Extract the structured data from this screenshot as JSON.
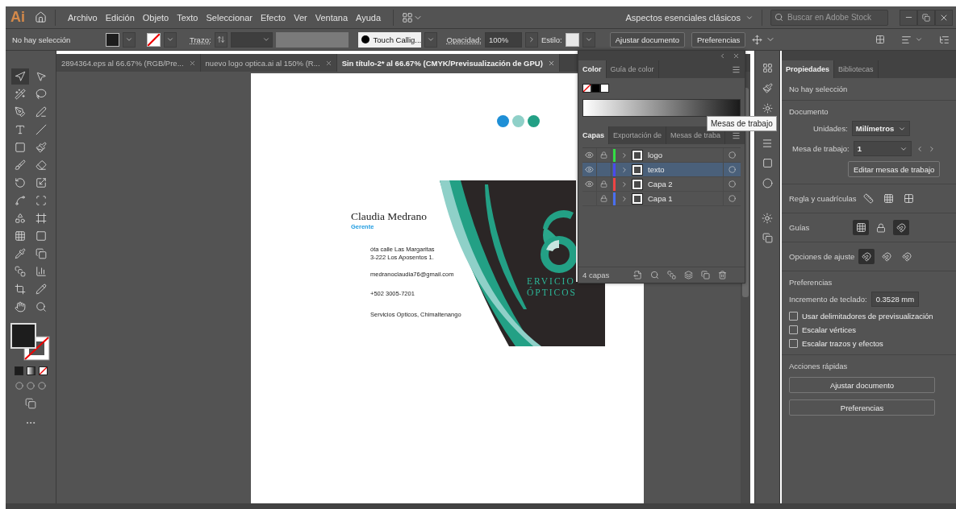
{
  "app": {
    "logo": "Ai"
  },
  "menu": [
    "Archivo",
    "Edición",
    "Objeto",
    "Texto",
    "Seleccionar",
    "Efecto",
    "Ver",
    "Ventana",
    "Ayuda"
  ],
  "workspace": "Aspectos esenciales clásicos",
  "search": {
    "placeholder": "Buscar en Adobe Stock"
  },
  "control_bar": {
    "selection": "No hay selección",
    "stroke_label": "Trazo:",
    "brush": "Touch Callig...",
    "opacity_label": "Opacidad:",
    "opacity": "100%",
    "style_label": "Estilo:",
    "buttons": [
      "Ajustar documento",
      "Preferencias"
    ]
  },
  "doc_tabs": [
    {
      "label": "2894364.eps al 66.67% (RGB/Pre...",
      "selected": false
    },
    {
      "label": "nuevo logo optica.ai al 150% (R...",
      "selected": false
    },
    {
      "label": "Sin título-2* al 66.67% (CMYK/Previsualización de GPU)",
      "selected": true
    }
  ],
  "card": {
    "name": "Claudia Medrano",
    "role": "Gerente",
    "address": [
      "óta calle Las Margaritas",
      "3-222  Los Aposentos 1."
    ],
    "email": "medranoclaudia76@gmail.com",
    "phone": "+502 3005-7201",
    "company": "Servicios Opticos, Chimaltenango",
    "logo_lines": [
      "ERVICIO",
      "ÓPTICOS"
    ],
    "dots": [
      {
        "color": "#1e8fd6"
      },
      {
        "color": "#8fd0c8"
      },
      {
        "color": "#23a085"
      }
    ]
  },
  "color_panel": {
    "tabs": [
      {
        "label": "Color",
        "selected": true
      },
      {
        "label": "Guía de color",
        "selected": false
      }
    ]
  },
  "layers_panel": {
    "tabs": [
      {
        "label": "Capas",
        "selected": true
      },
      {
        "label": "Exportación de",
        "selected": false
      },
      {
        "label": "Mesas de traba",
        "selected": false
      }
    ],
    "layers": [
      {
        "name": "logo",
        "visible": true,
        "locked": true,
        "color": "#33dd44",
        "selected": false
      },
      {
        "name": "texto",
        "visible": true,
        "locked": false,
        "color": "#4a4af0",
        "selected": true
      },
      {
        "name": "Capa 2",
        "visible": true,
        "locked": true,
        "color": "#ee4444",
        "selected": false
      },
      {
        "name": "Capa 1",
        "visible": false,
        "locked": true,
        "color": "#4a6ff0",
        "selected": false
      }
    ],
    "count": "4 capas"
  },
  "tooltip": "Mesas de trabajo",
  "properties": {
    "tabs": [
      {
        "label": "Propiedades",
        "selected": true
      },
      {
        "label": "Bibliotecas",
        "selected": false
      }
    ],
    "selection": "No hay selección",
    "document_heading": "Documento",
    "units_label": "Unidades:",
    "units": "Milímetros",
    "artboard_label": "Mesa de trabajo:",
    "artboard": "1",
    "edit_button": "Editar mesas de trabajo",
    "rulers_label": "Regla y cuadrículas",
    "guides_label": "Guías",
    "snap_label": "Opciones de ajuste",
    "prefs_heading": "Preferencias",
    "increment_label": "Incremento de teclado:",
    "increment": "0.3528 mm",
    "options": [
      {
        "label": "Usar delimitadores de previsualización",
        "checked": false
      },
      {
        "label": "Escalar vértices",
        "checked": false
      },
      {
        "label": "Escalar trazos y efectos",
        "checked": false
      }
    ],
    "quick_heading": "Acciones rápidas",
    "quick_buttons": [
      "Ajustar documento",
      "Preferencias"
    ]
  }
}
